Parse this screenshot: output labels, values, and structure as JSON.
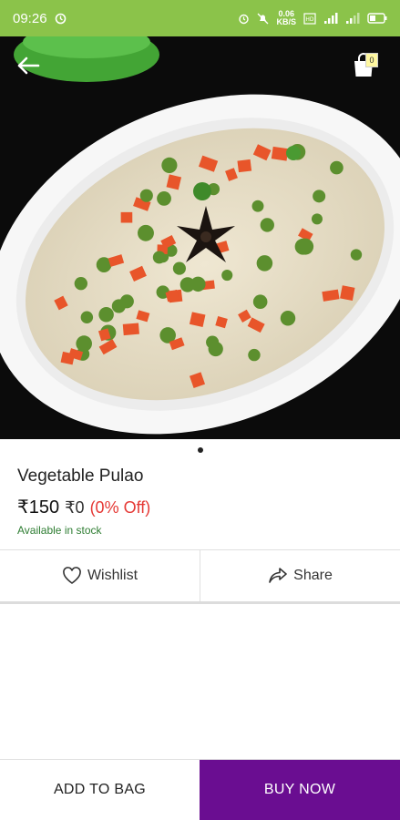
{
  "status_bar": {
    "time": "09:26",
    "net_speed_value": "0.06",
    "net_speed_unit": "KB/S",
    "icons": [
      "sync-icon",
      "alarm-icon",
      "silent-icon",
      "volte-icon",
      "signal-icon",
      "signal-icon",
      "battery-icon"
    ]
  },
  "header": {
    "back_icon": "arrow-left-icon",
    "bag_icon": "shopping-bag-icon",
    "bag_count": "0"
  },
  "product": {
    "name": "Vegetable Pulao",
    "price": "₹150",
    "mrp": "₹0",
    "discount": "(0% Off)",
    "stock": "Available in stock",
    "image_description_icon": "food-image"
  },
  "actions": {
    "wishlist_label": "Wishlist",
    "share_label": "Share"
  },
  "bottom": {
    "add_to_bag_label": "ADD TO BAG",
    "buy_now_label": "BUY NOW"
  },
  "colors": {
    "status_bar": "#8bc34a",
    "buy_now": "#6a0d91",
    "discount": "#e53935",
    "stock": "#2e7d32"
  }
}
